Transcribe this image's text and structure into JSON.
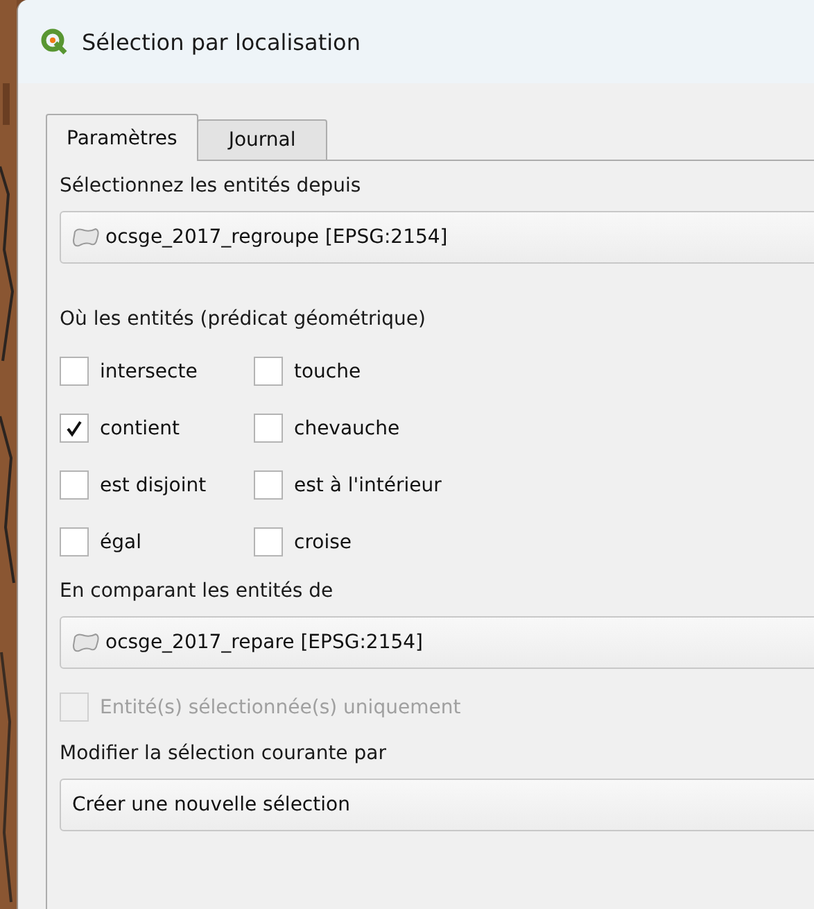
{
  "window": {
    "title": "Sélection par localisation"
  },
  "tabs": [
    {
      "label": "Paramètres",
      "selected": true
    },
    {
      "label": "Journal",
      "selected": false
    }
  ],
  "source": {
    "label": "Sélectionnez les entités depuis",
    "value": "ocsge_2017_regroupe [EPSG:2154]"
  },
  "predicate": {
    "label": "Où les entités (prédicat géométrique)",
    "options": [
      {
        "label": "intersecte",
        "checked": false
      },
      {
        "label": "touche",
        "checked": false
      },
      {
        "label": "contient",
        "checked": true
      },
      {
        "label": "chevauche",
        "checked": false
      },
      {
        "label": "est disjoint",
        "checked": false
      },
      {
        "label": "est à l'intérieur",
        "checked": false
      },
      {
        "label": "égal",
        "checked": false
      },
      {
        "label": "croise",
        "checked": false
      }
    ]
  },
  "compare": {
    "label": "En comparant les entités de",
    "value": "ocsge_2017_repare [EPSG:2154]"
  },
  "selected_only": {
    "label": "Entité(s) sélectionnée(s) uniquement",
    "checked": false,
    "disabled": true
  },
  "modify": {
    "label": "Modifier la sélection courante par",
    "value": "Créer une nouvelle sélection"
  }
}
